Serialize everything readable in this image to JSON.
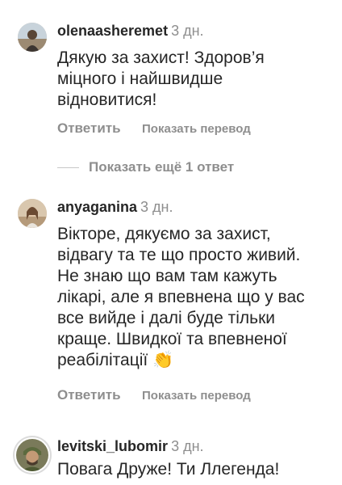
{
  "comments": [
    {
      "username": "olenaasheremet",
      "time": "3 дн.",
      "text": "Дякую за захист! Здоров’я\nміцного і найшвидше\nвідновитися!",
      "reply_label": "Ответить",
      "translate_label": "Показать перевод"
    },
    {
      "username": "anyaganina",
      "time": "3 дн.",
      "text": "Вікторе, дякуємо за захист,\nвідвагу та те що просто живий.\nНе знаю що вам там кажуть\nлікарі, але я впевнена що у вас\nвсе вийде і далі буде тільки\nкраще. Швидкої та впевненої\nреабілітації",
      "emoji": "👏",
      "reply_label": "Ответить",
      "translate_label": "Показать перевод"
    },
    {
      "username": "levitski_lubomir",
      "time": "3 дн.",
      "text": "Повага Друже! Ти Ллегенда!"
    }
  ],
  "more_replies_label": "Показать ещё 1 ответ",
  "icons": {
    "avatar_1": "user-avatar-photo",
    "avatar_2": "user-avatar-photo",
    "avatar_3": "user-avatar-photo",
    "emoji": "clapping-hands"
  }
}
